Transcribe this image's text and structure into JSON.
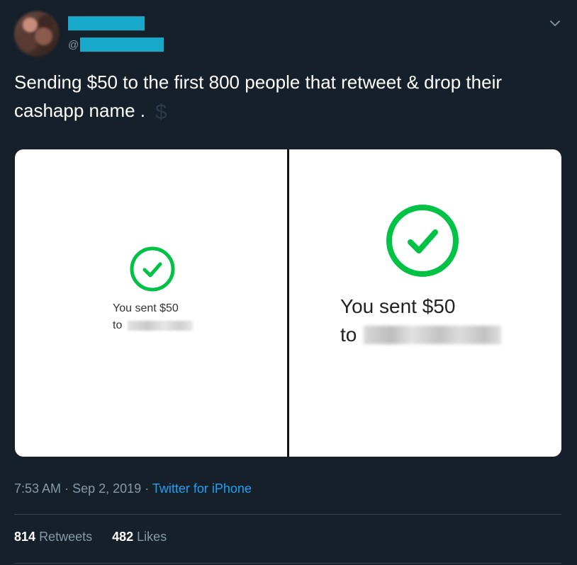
{
  "user": {
    "handle_prefix": "@"
  },
  "tweet": {
    "text": "Sending $50 to the first 800 people that retweet & drop their cashapp name .",
    "emoji": "$"
  },
  "media": {
    "left": {
      "sent_line": "You sent $50",
      "to_word": "to"
    },
    "right": {
      "sent_line": "You sent $50",
      "to_word": "to"
    },
    "check_color": "#00c244"
  },
  "meta": {
    "time": "7:53 AM",
    "separator": "·",
    "date": "Sep 2, 2019",
    "source": "Twitter for iPhone"
  },
  "stats": {
    "retweets_count": "814",
    "retweets_label": "Retweets",
    "likes_count": "482",
    "likes_label": "Likes"
  },
  "colors": {
    "background": "#15202b",
    "link": "#1da1f2",
    "muted": "#8899a6",
    "redaction": "#18a8c9"
  }
}
